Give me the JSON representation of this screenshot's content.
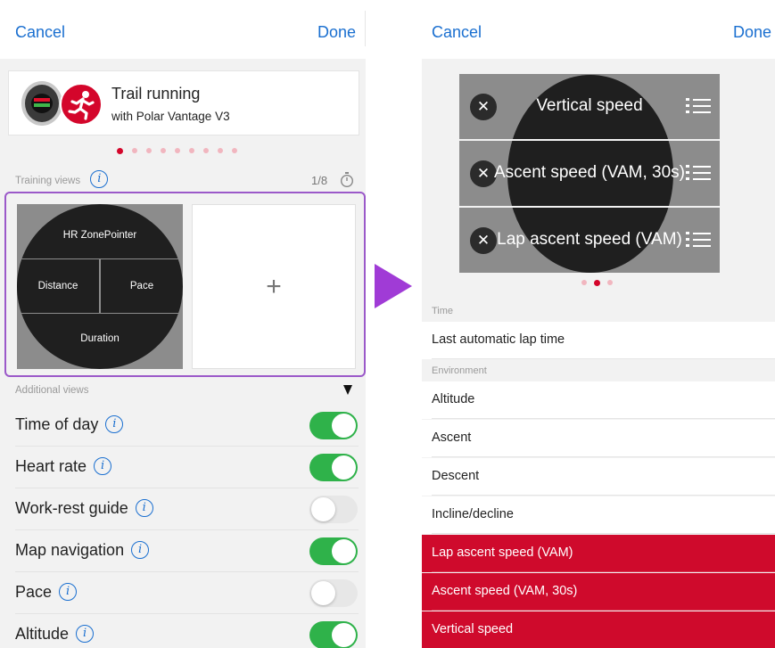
{
  "left_screen": {
    "cancel_label": "Cancel",
    "done_label": "Done",
    "profile": {
      "title": "Trail running",
      "subtitle": "with Polar Vantage V3"
    },
    "page_dots": {
      "count": 9,
      "active_index": 0
    },
    "training_views": {
      "label": "Training views",
      "counter": "1/8",
      "fields": {
        "top": "HR ZonePointer",
        "middle_left": "Distance",
        "middle_right": "Pace",
        "bottom": "Duration"
      },
      "add_symbol": "+"
    },
    "additional_views_label": "Additional views",
    "toggles": [
      {
        "label": "Time of day",
        "on": true
      },
      {
        "label": "Heart rate",
        "on": true
      },
      {
        "label": "Work-rest guide",
        "on": false
      },
      {
        "label": "Map navigation",
        "on": true
      },
      {
        "label": "Pace",
        "on": false
      },
      {
        "label": "Altitude",
        "on": true
      }
    ],
    "info_glyph": "i"
  },
  "right_screen": {
    "cancel_label": "Cancel",
    "done_label": "Done",
    "selected_fields": [
      {
        "remove_glyph": "✕",
        "label": "Vertical speed"
      },
      {
        "remove_glyph": "✕",
        "label": "Ascent speed (VAM, 30s)"
      },
      {
        "remove_glyph": "✕",
        "label": "Lap ascent speed (VAM)"
      }
    ],
    "page_dots": {
      "count": 3,
      "active_index": 1
    },
    "sections": [
      {
        "header": "Time",
        "items": [
          {
            "label": "Last automatic lap time",
            "selected": false
          }
        ]
      },
      {
        "header": "Environment",
        "items": [
          {
            "label": "Altitude",
            "selected": false
          },
          {
            "label": "Ascent",
            "selected": false
          },
          {
            "label": "Descent",
            "selected": false
          },
          {
            "label": "Incline/decline",
            "selected": false
          },
          {
            "label": "Lap ascent speed (VAM)",
            "selected": true
          },
          {
            "label": "Ascent speed (VAM, 30s)",
            "selected": true
          },
          {
            "label": "Vertical speed",
            "selected": true
          }
        ]
      }
    ]
  },
  "colors": {
    "link": "#1a6fd0",
    "accent_red": "#d4062b",
    "toggle_on": "#2fb24a",
    "highlight_purple": "#9b59c9",
    "arrow_purple": "#a03bd6",
    "selected_row": "#cf0a2c"
  }
}
